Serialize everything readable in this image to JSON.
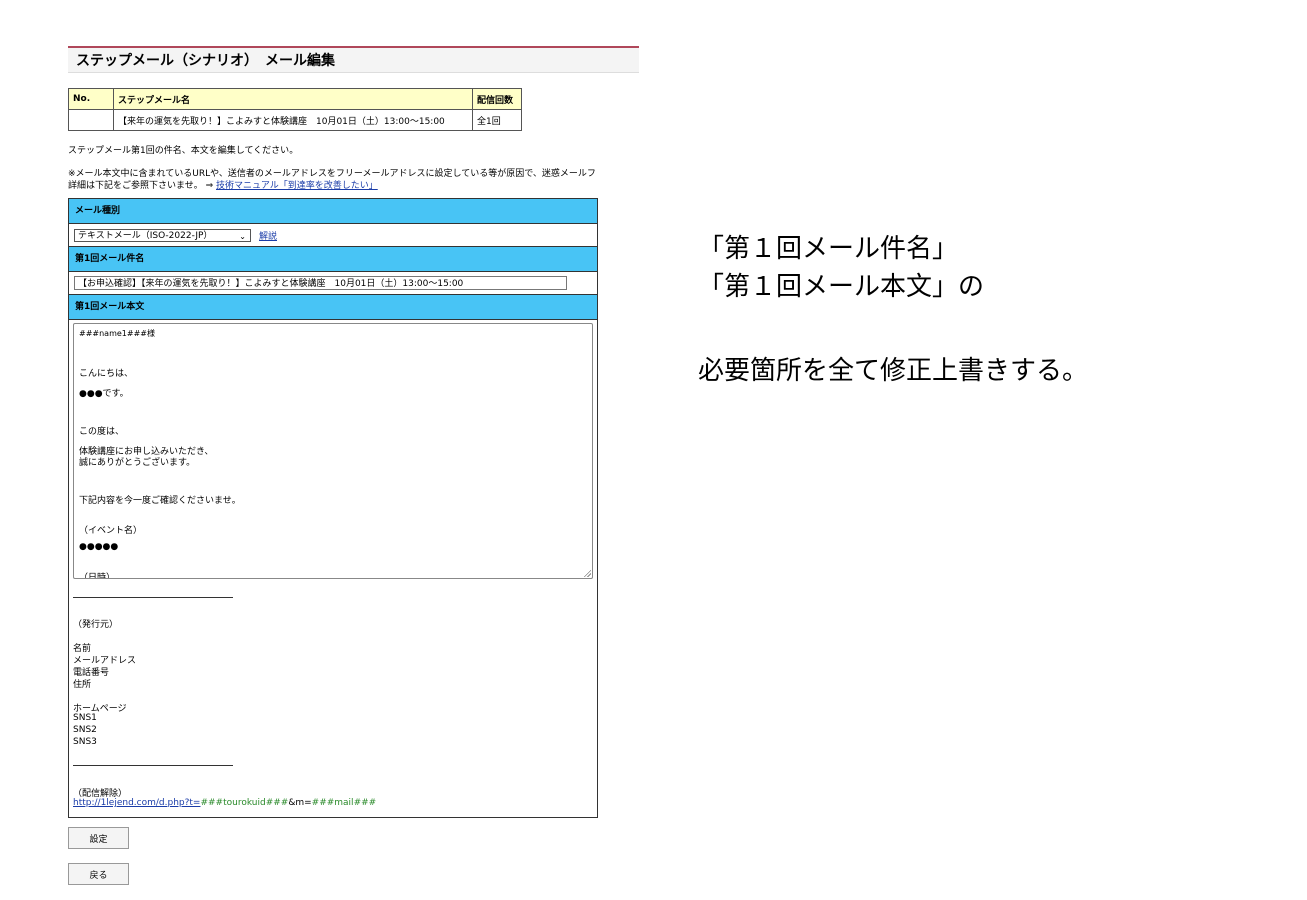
{
  "page_title": "ステップメール（シナリオ）　メール編集",
  "scenario_table": {
    "headers": [
      "No.",
      "ステップメール名",
      "配信回数"
    ],
    "row": [
      "",
      "【来年の運気を先取り！】こよみすと体験講座　10月01日（土）13:00〜15:00",
      "全1回"
    ]
  },
  "intro_text": "ステップメール第1回の件名、本文を編集してください。",
  "note_line1": "※メール本文中に含まれているURLや、送信者のメールアドレスをフリーメールアドレスに設定している等が原因で、迷惑メールフ",
  "note_line2": "詳細は下記をご参照下さいませ。 ⇒ ",
  "manual_link": "技術マニュアル「到達率を改善したい」",
  "sections": {
    "mail_type": "メール種別",
    "subject": "第1回メール件名",
    "body": "第1回メール本文"
  },
  "mail_type_select": "テキストメール（ISO-2022-JP）",
  "help_link": "解説",
  "subject_value": "【お申込確認】【来年の運気を先取り！】こよみすと体験講座　10月01日（土）13:00〜15:00",
  "body_lines": [
    "###name1###様",
    "こんにちは、",
    "●●●です。",
    "この度は、",
    "体験講座にお申し込みいただき、",
    "誠にありがとうございます。",
    "下記内容を今一度ご確認くださいませ。",
    "（イベント名）",
    "●●●●●",
    "（日時）"
  ],
  "footer": {
    "publisher": "（発行元）",
    "name": "名前",
    "email": "メールアドレス",
    "phone": "電話番号",
    "address": "住所",
    "homepage": "ホームページ",
    "sns1": "SNS1",
    "sns2": "SNS2",
    "sns3": "SNS3",
    "unsubscribe": "（配信解除）",
    "url_a": "http://1lejend.com/d.php?t=",
    "url_b": "###tourokuid###",
    "url_c": "&m=",
    "url_d": "###mail###"
  },
  "buttons": {
    "save": "設定",
    "back": "戻る"
  },
  "annotation": {
    "line1": "「第１回メール件名」",
    "line2": "「第１回メール本文」の",
    "line3": "必要箇所を全て修正上書きする。"
  }
}
